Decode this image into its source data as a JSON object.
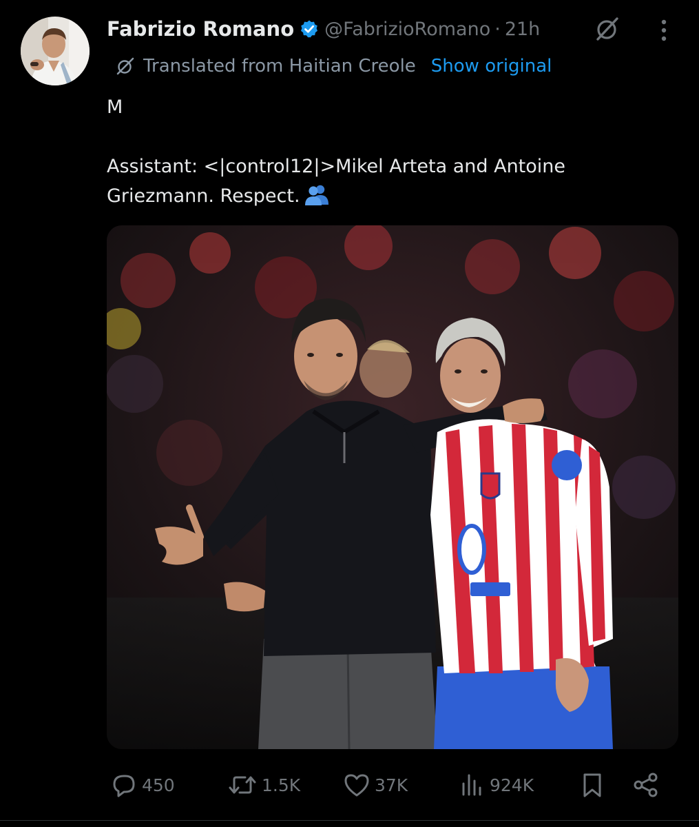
{
  "post": {
    "author": {
      "name": "Fabrizio Romano",
      "handle": "@FabrizioRomano",
      "verified": true,
      "avatar_icon": "profile-photo"
    },
    "separator": "·",
    "time": "21h",
    "translation": {
      "icon": "translate-icon",
      "label": "Translated from Haitian Creole",
      "show_original": "Show original"
    },
    "text": {
      "line1": "M",
      "line2": "Assistant: <|control12|>Mikel Arteta and Antoine Griezmann. Respect.",
      "emoji": "busts-in-silhouette"
    },
    "media": {
      "type": "photo"
    }
  },
  "actions": {
    "replies": "450",
    "reposts": "1.5K",
    "likes": "37K",
    "views": "924K"
  },
  "colors": {
    "background": "#000000",
    "text": "#e7e9ea",
    "secondary": "#71767b",
    "accent": "#1d9bf0",
    "badge": "#1d9bf0"
  }
}
